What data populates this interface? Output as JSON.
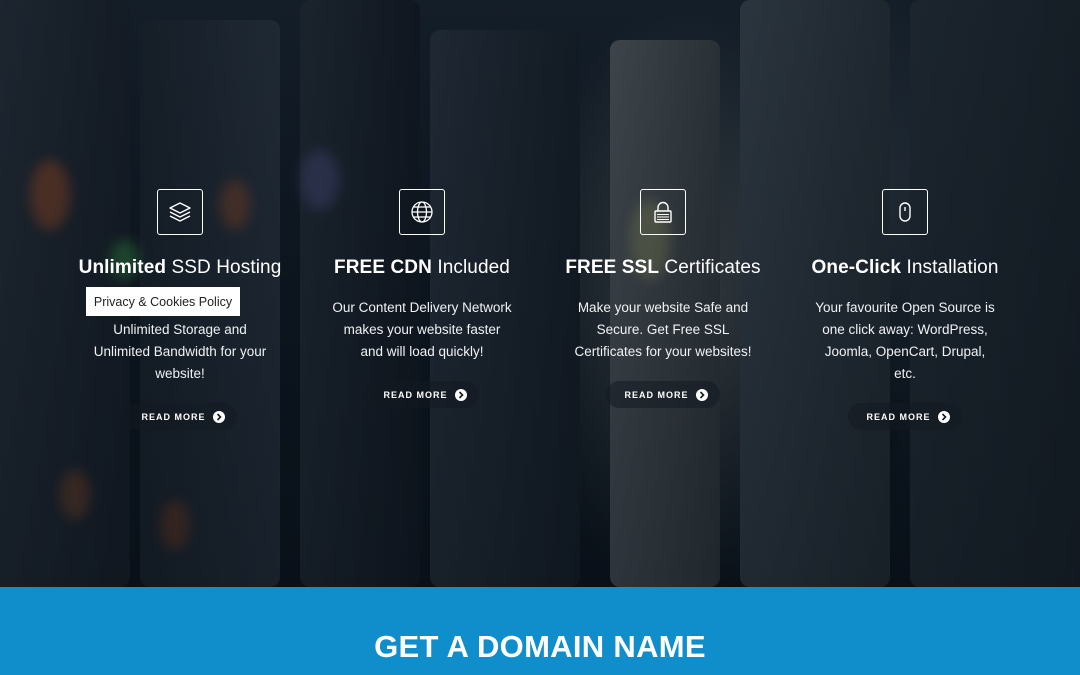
{
  "features": [
    {
      "title_strong": "Unlimited",
      "title_rest": " SSD Hosting",
      "icon": "layers-icon",
      "description": "Unlimited Storage and Unlimited Bandwidth for your website!",
      "cta": "READ MORE"
    },
    {
      "title_strong": "FREE CDN",
      "title_rest": " Included",
      "icon": "globe-icon",
      "description": "Our Content Delivery Network makes your website faster and will load quickly!",
      "cta": "READ MORE"
    },
    {
      "title_strong": "FREE SSL",
      "title_rest": " Certificates",
      "icon": "lock-icon",
      "description": "Make your website Safe and Secure. Get Free SSL Certificates for your websites!",
      "cta": "READ MORE"
    },
    {
      "title_strong": "One-Click",
      "title_rest": " Installation",
      "icon": "mouse-icon",
      "description": "Your favourite Open Source is one click away: WordPress, Joomla, OpenCart, Drupal, etc.",
      "cta": "READ MORE"
    }
  ],
  "privacy_link": "Privacy & Cookies Policy",
  "domain_section": {
    "title": "GET A DOMAIN NAME"
  },
  "colors": {
    "accent": "#0f8ecb",
    "text": "#ffffff"
  }
}
